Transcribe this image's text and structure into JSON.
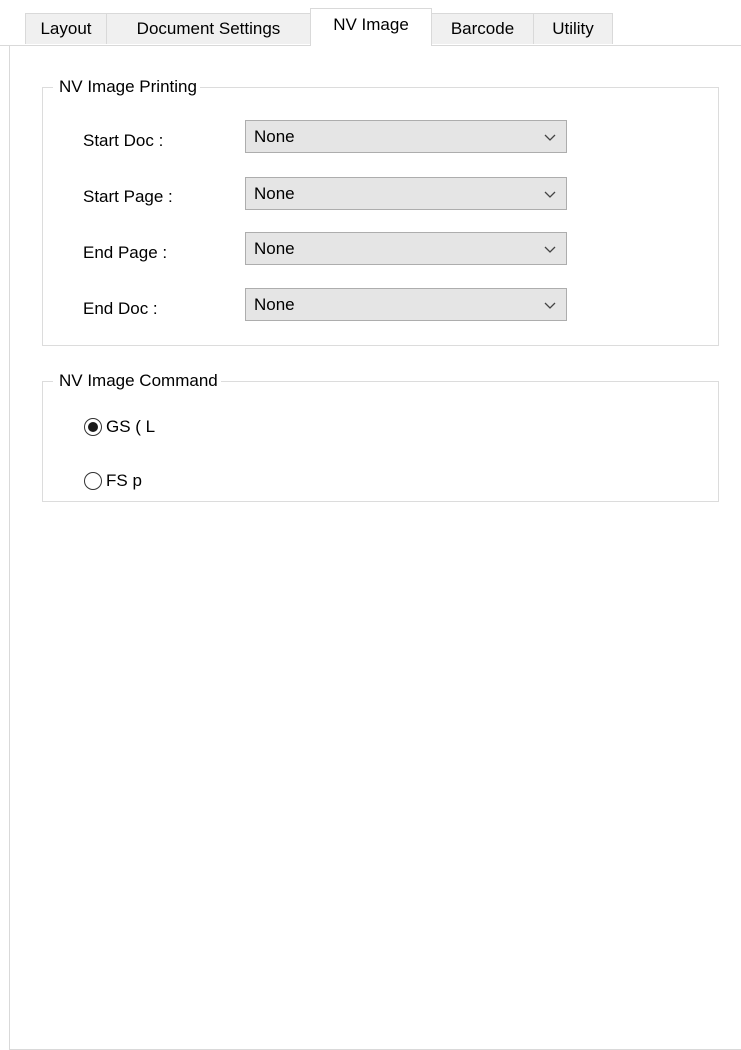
{
  "tabs": [
    {
      "label": "Layout",
      "active": false
    },
    {
      "label": "Document Settings",
      "active": false
    },
    {
      "label": "NV Image",
      "active": true
    },
    {
      "label": "Barcode",
      "active": false
    },
    {
      "label": "Utility",
      "active": false
    }
  ],
  "printing_group": {
    "legend": "NV Image Printing",
    "fields": [
      {
        "label": "Start Doc :",
        "value": "None"
      },
      {
        "label": "Start Page :",
        "value": "None"
      },
      {
        "label": "End Page :",
        "value": "None"
      },
      {
        "label": "End Doc :",
        "value": "None"
      }
    ]
  },
  "command_group": {
    "legend": "NV Image Command",
    "options": [
      {
        "label": "GS ( L",
        "selected": true
      },
      {
        "label": "FS p",
        "selected": false
      }
    ]
  }
}
